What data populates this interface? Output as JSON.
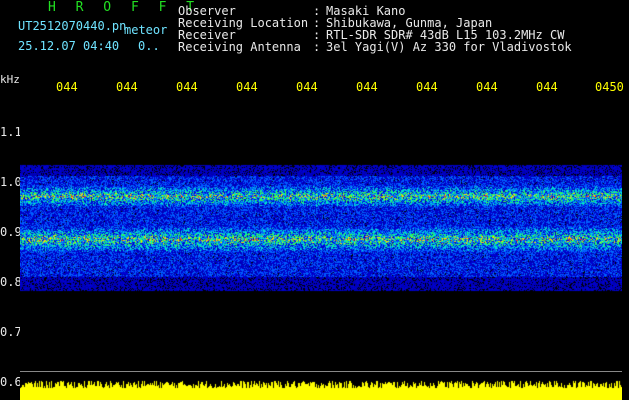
{
  "header": {
    "title": "H R O F F T",
    "filename": "UT2512070440.pn",
    "badge": "meteor",
    "datetime": "25.12.07 04:40",
    "counter": "0..",
    "labels": {
      "observer": "Observer",
      "location": "Receiving Location",
      "receiver": "Receiver",
      "antenna": "Receiving Antenna"
    },
    "separators": [
      ":",
      ":",
      ":",
      ":"
    ],
    "values": {
      "observer": "Masaki Kano",
      "location": "Shibukawa, Gunma, Japan",
      "receiver": "RTL-SDR SDR# 43dB L15 103.2MHz CW",
      "antenna": "3el Yagi(V) Az 330 for Vladivostok"
    }
  },
  "axis": {
    "y_unit": "kHz",
    "y_ticks": [
      "1.1",
      "1.0",
      "0.9",
      "0.8",
      "0.7",
      "0.6"
    ],
    "x_ticks": [
      "044",
      "044",
      "044",
      "044",
      "044",
      "044",
      "044",
      "044",
      "044",
      "0450"
    ]
  },
  "colors": {
    "header_title": "#22e022",
    "label_text": "#e9e9e9",
    "tick_text": "#ffff00",
    "noise_floor": "#ffff00"
  }
}
